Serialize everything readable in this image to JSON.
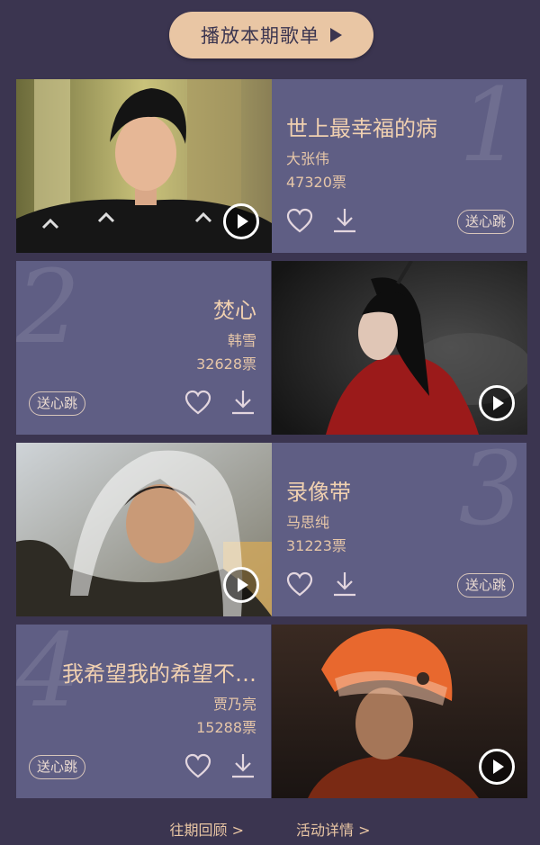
{
  "header": {
    "play_all_label": "播放本期歌单"
  },
  "songs": [
    {
      "rank": "1",
      "title": "世上最幸福的病",
      "artist": "大张伟",
      "votes": "47320票",
      "send_label": "送心跳"
    },
    {
      "rank": "2",
      "title": "焚心",
      "artist": "韩雪",
      "votes": "32628票",
      "send_label": "送心跳"
    },
    {
      "rank": "3",
      "title": "录像带",
      "artist": "马思纯",
      "votes": "31223票",
      "send_label": "送心跳"
    },
    {
      "rank": "4",
      "title": "我希望我的希望不…",
      "artist": "贾乃亮",
      "votes": "15288票",
      "send_label": "送心跳"
    }
  ],
  "footer": {
    "past_review": "往期回顾 >",
    "activity_details": "活动详情 >"
  },
  "colors": {
    "background": "#3b3550",
    "panel": "#5f5e84",
    "accent": "#e9c6a4"
  }
}
